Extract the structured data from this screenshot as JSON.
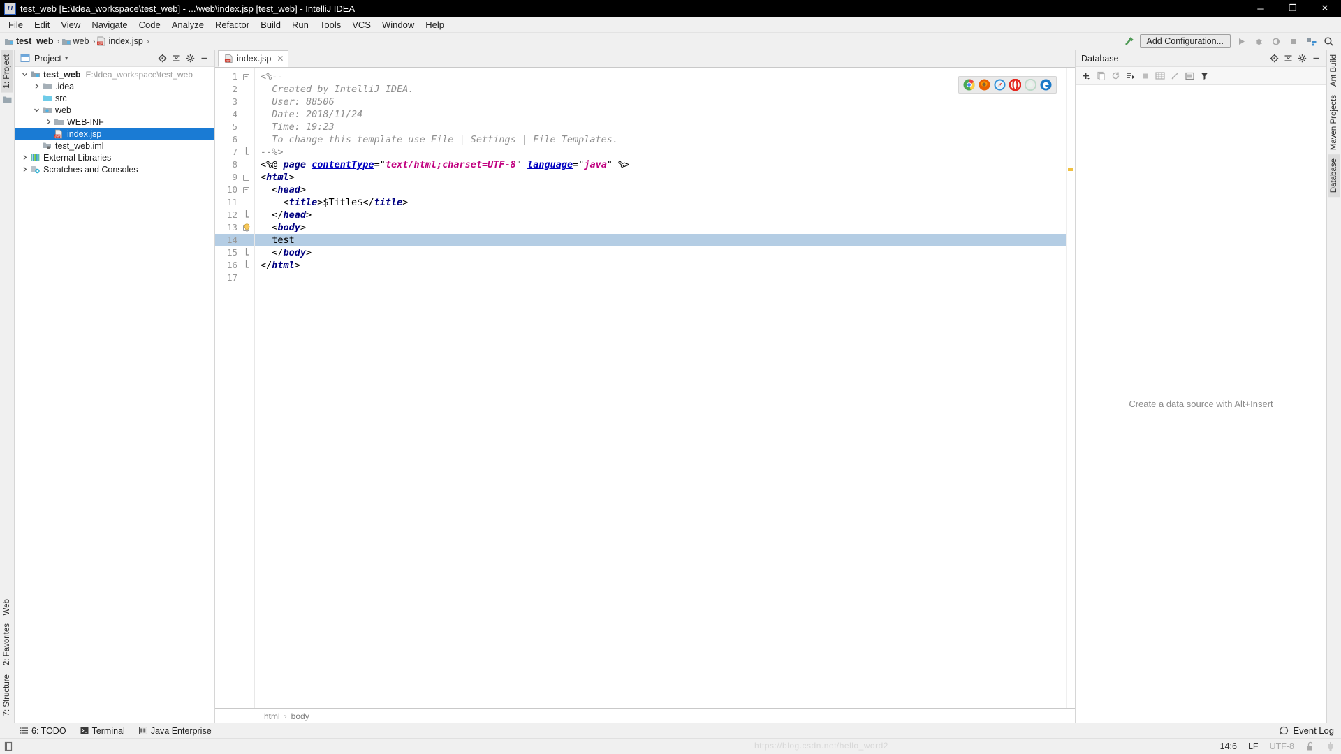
{
  "window": {
    "title": "test_web [E:\\Idea_workspace\\test_web] - ...\\web\\index.jsp [test_web] - IntelliJ IDEA",
    "logo_text": "IJ",
    "minimize": "─",
    "maximize": "❐",
    "close": "✕"
  },
  "menubar": {
    "items": [
      {
        "label": "File"
      },
      {
        "label": "Edit"
      },
      {
        "label": "View"
      },
      {
        "label": "Navigate"
      },
      {
        "label": "Code"
      },
      {
        "label": "Analyze"
      },
      {
        "label": "Refactor"
      },
      {
        "label": "Build"
      },
      {
        "label": "Run"
      },
      {
        "label": "Tools"
      },
      {
        "label": "VCS"
      },
      {
        "label": "Window"
      },
      {
        "label": "Help"
      }
    ]
  },
  "navbar": {
    "crumbs": [
      {
        "label": "test_web",
        "icon": "module-icon"
      },
      {
        "label": "web",
        "icon": "folder-icon"
      },
      {
        "label": "index.jsp",
        "icon": "jsp-file-icon"
      }
    ],
    "separator": "›",
    "add_configuration": "Add Configuration...",
    "icons": [
      "build-hammer-icon",
      "run-icon",
      "debug-icon",
      "run-coverage-icon",
      "stop-icon",
      "project-structure-icon",
      "search-everywhere-icon"
    ]
  },
  "left_strip": {
    "tabs": [
      {
        "label": "1: Project",
        "active": true
      },
      {
        "label": "7: Structure",
        "active": false
      },
      {
        "label": "2: Favorites",
        "active": false
      },
      {
        "label": "Web",
        "active": false
      }
    ]
  },
  "right_strip": {
    "tabs": [
      {
        "label": "Ant Build"
      },
      {
        "label": "Maven Projects"
      },
      {
        "label": "Database",
        "active": true
      }
    ]
  },
  "project_panel": {
    "title": "Project",
    "dropdown_caret": "▾",
    "actions": [
      "target-icon",
      "collapse-all-icon",
      "settings-gear-icon",
      "hide-icon"
    ],
    "tree": [
      {
        "depth": 0,
        "arrow": "expanded",
        "icon": "module-icon",
        "label": "test_web",
        "bold": true,
        "path": "E:\\Idea_workspace\\test_web",
        "selected": false
      },
      {
        "depth": 1,
        "arrow": "collapsed",
        "icon": "folder-icon",
        "label": ".idea",
        "bold": false,
        "path": "",
        "selected": false
      },
      {
        "depth": 1,
        "arrow": "none",
        "icon": "source-folder-icon",
        "label": "src",
        "bold": false,
        "path": "",
        "selected": false
      },
      {
        "depth": 1,
        "arrow": "expanded",
        "icon": "web-folder-icon",
        "label": "web",
        "bold": false,
        "path": "",
        "selected": false
      },
      {
        "depth": 2,
        "arrow": "collapsed",
        "icon": "folder-icon",
        "label": "WEB-INF",
        "bold": false,
        "path": "",
        "selected": false
      },
      {
        "depth": 2,
        "arrow": "none",
        "icon": "jsp-file-icon",
        "label": "index.jsp",
        "bold": false,
        "path": "",
        "selected": true
      },
      {
        "depth": 1,
        "arrow": "none",
        "icon": "iml-file-icon",
        "label": "test_web.iml",
        "bold": false,
        "path": "",
        "selected": false
      },
      {
        "depth": 0,
        "arrow": "collapsed",
        "icon": "libraries-icon",
        "label": "External Libraries",
        "bold": false,
        "path": "",
        "selected": false
      },
      {
        "depth": 0,
        "arrow": "collapsed",
        "icon": "scratches-icon",
        "label": "Scratches and Consoles",
        "bold": false,
        "path": "",
        "selected": false
      }
    ]
  },
  "editor": {
    "tab": {
      "label": "index.jsp",
      "icon": "jsp-file-icon",
      "close": "✕"
    },
    "browsers": [
      "chrome-icon",
      "firefox-icon",
      "safari-icon",
      "opera-icon",
      "disabled-browser-icon",
      "edge-icon"
    ],
    "highlighted_line": 14,
    "lines": [
      {
        "n": 1,
        "fold": "start",
        "bulb": false,
        "tokens": [
          {
            "t": "<%--",
            "c": "cm"
          }
        ]
      },
      {
        "n": 2,
        "fold": "none",
        "bulb": false,
        "tokens": [
          {
            "t": "  Created by IntelliJ IDEA.",
            "c": "cm"
          }
        ]
      },
      {
        "n": 3,
        "fold": "none",
        "bulb": false,
        "tokens": [
          {
            "t": "  User: 88506",
            "c": "cm"
          }
        ]
      },
      {
        "n": 4,
        "fold": "none",
        "bulb": false,
        "tokens": [
          {
            "t": "  Date: 2018/11/24",
            "c": "cm"
          }
        ]
      },
      {
        "n": 5,
        "fold": "none",
        "bulb": false,
        "tokens": [
          {
            "t": "  Time: 19:23",
            "c": "cm"
          }
        ]
      },
      {
        "n": 6,
        "fold": "none",
        "bulb": false,
        "tokens": [
          {
            "t": "  To change this template use File | Settings | File Templates.",
            "c": "cm"
          }
        ]
      },
      {
        "n": 7,
        "fold": "end",
        "bulb": false,
        "tokens": [
          {
            "t": "--%>",
            "c": "cm"
          }
        ]
      },
      {
        "n": 8,
        "fold": "none",
        "bulb": false,
        "tokens": [
          {
            "t": "<%@ ",
            "c": "plain"
          },
          {
            "t": "page ",
            "c": "kw"
          },
          {
            "t": "contentType",
            "c": "attr"
          },
          {
            "t": "=",
            "c": "plain"
          },
          {
            "t": "\"",
            "c": "plain"
          },
          {
            "t": "text/html;charset=UTF-8",
            "c": "jspstr"
          },
          {
            "t": "\"",
            "c": "plain"
          },
          {
            "t": " ",
            "c": "plain"
          },
          {
            "t": "language",
            "c": "attr"
          },
          {
            "t": "=",
            "c": "plain"
          },
          {
            "t": "\"",
            "c": "plain"
          },
          {
            "t": "java",
            "c": "jspstr"
          },
          {
            "t": "\"",
            "c": "plain"
          },
          {
            "t": " %>",
            "c": "plain"
          }
        ]
      },
      {
        "n": 9,
        "fold": "start",
        "bulb": false,
        "tokens": [
          {
            "t": "<",
            "c": "brk"
          },
          {
            "t": "html",
            "c": "tag"
          },
          {
            "t": ">",
            "c": "brk"
          }
        ]
      },
      {
        "n": 10,
        "fold": "start",
        "bulb": false,
        "tokens": [
          {
            "t": "  <",
            "c": "brk"
          },
          {
            "t": "head",
            "c": "tag"
          },
          {
            "t": ">",
            "c": "brk"
          }
        ]
      },
      {
        "n": 11,
        "fold": "none",
        "bulb": false,
        "tokens": [
          {
            "t": "    <",
            "c": "brk"
          },
          {
            "t": "title",
            "c": "tag"
          },
          {
            "t": ">",
            "c": "brk"
          },
          {
            "t": "$Title$",
            "c": "plain"
          },
          {
            "t": "</",
            "c": "brk"
          },
          {
            "t": "title",
            "c": "tag"
          },
          {
            "t": ">",
            "c": "brk"
          }
        ]
      },
      {
        "n": 12,
        "fold": "end",
        "bulb": false,
        "tokens": [
          {
            "t": "  </",
            "c": "brk"
          },
          {
            "t": "head",
            "c": "tag"
          },
          {
            "t": ">",
            "c": "brk"
          }
        ]
      },
      {
        "n": 13,
        "fold": "start",
        "bulb": true,
        "tokens": [
          {
            "t": "  <",
            "c": "brk"
          },
          {
            "t": "body",
            "c": "tag"
          },
          {
            "t": ">",
            "c": "brk"
          }
        ]
      },
      {
        "n": 14,
        "fold": "none",
        "bulb": false,
        "tokens": [
          {
            "t": "  test",
            "c": "plain"
          }
        ]
      },
      {
        "n": 15,
        "fold": "end",
        "bulb": false,
        "tokens": [
          {
            "t": "  </",
            "c": "brk"
          },
          {
            "t": "body",
            "c": "tag"
          },
          {
            "t": ">",
            "c": "brk"
          }
        ]
      },
      {
        "n": 16,
        "fold": "end",
        "bulb": false,
        "tokens": [
          {
            "t": "</",
            "c": "brk"
          },
          {
            "t": "html",
            "c": "tag"
          },
          {
            "t": ">",
            "c": "brk"
          }
        ]
      },
      {
        "n": 17,
        "fold": "none",
        "bulb": false,
        "tokens": [
          {
            "t": "",
            "c": "plain"
          }
        ]
      }
    ],
    "breadcrumb": [
      "html",
      "body"
    ],
    "breadcrumb_sep": "›",
    "marker_color": "#f0c040"
  },
  "database_panel": {
    "title": "Database",
    "empty_text": "Create a data source with Alt+Insert",
    "header_actions": [
      "target-icon",
      "collapse-all-icon",
      "settings-gear-icon",
      "hide-icon"
    ],
    "toolbar_icons": [
      "add-icon",
      "duplicate-icon",
      "refresh-icon",
      "run-sql-icon",
      "stop-icon",
      "table-icon",
      "edit-icon",
      "console-icon",
      "filter-icon"
    ]
  },
  "bottom_bar": {
    "items": [
      {
        "label": "6: TODO",
        "underline_char": "6",
        "icon": "todo-icon"
      },
      {
        "label": "Terminal",
        "icon": "terminal-icon"
      },
      {
        "label": "Java Enterprise",
        "icon": "java-enterprise-icon"
      }
    ],
    "event_log": "Event Log",
    "event_log_icon": "event-log-icon"
  },
  "status_bar": {
    "caret_position": "14:6",
    "line_separator": "LF",
    "encoding": "UTF-8",
    "lock_icon": "unlocked-icon",
    "inspection_icon": "inspections-icon",
    "watermark": "https://blog.csdn.net/hello_word2"
  },
  "colors": {
    "selection_blue": "#1a7bd4",
    "highlight_line": "#b4cde4",
    "titlebar_bg": "#000000",
    "panel_bg": "#f0f0f0"
  }
}
